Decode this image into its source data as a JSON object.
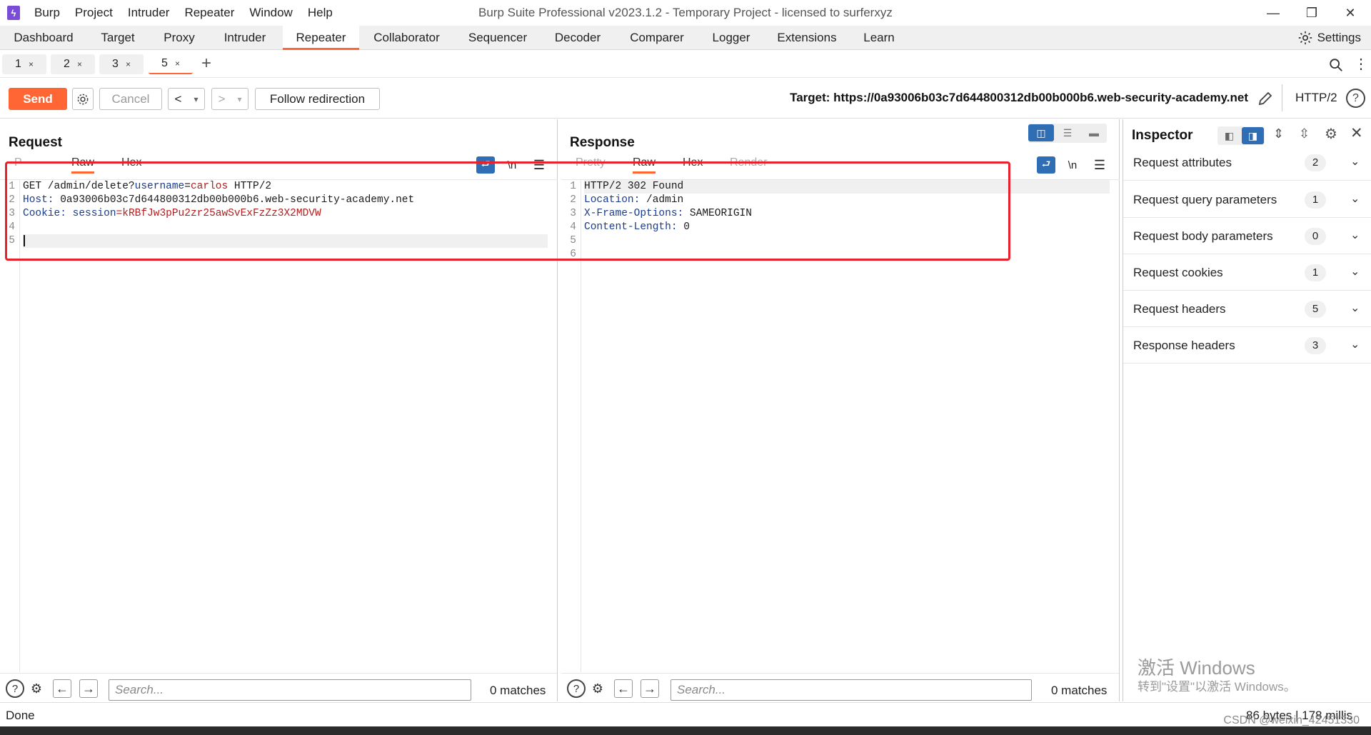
{
  "titlebar": {
    "menu": [
      "Burp",
      "Project",
      "Intruder",
      "Repeater",
      "Window",
      "Help"
    ],
    "title": "Burp Suite Professional v2023.1.2 - Temporary Project - licensed to surferxyz"
  },
  "main_tabs": [
    "Dashboard",
    "Target",
    "Proxy",
    "Intruder",
    "Repeater",
    "Collaborator",
    "Sequencer",
    "Decoder",
    "Comparer",
    "Logger",
    "Extensions",
    "Learn"
  ],
  "active_main_tab": "Repeater",
  "settings_label": "Settings",
  "sub_tabs": [
    {
      "label": "1",
      "close": "×"
    },
    {
      "label": "2",
      "close": "×"
    },
    {
      "label": "3",
      "close": "×"
    },
    {
      "label": "5",
      "close": "×"
    }
  ],
  "add_tab": "+",
  "toolbar": {
    "send": "Send",
    "cancel": "Cancel",
    "follow": "Follow redirection",
    "target": "Target: https://0a93006b03c7d644800312db00b000b6.web-security-academy.net",
    "http": "HTTP/2",
    "nav_back": "<",
    "nav_forward": ">",
    "dropdown": "▾"
  },
  "request": {
    "title": "Request",
    "view_tabs": [
      "P",
      "Raw",
      "Hex"
    ],
    "active_view": "Raw",
    "line_numbers": [
      "1",
      "2",
      "3",
      "4",
      "5"
    ],
    "lines": [
      {
        "a": "GET /admin/delete?",
        "b": "username",
        "c": "=",
        "d": "carlos",
        "e": " HTTP/2"
      },
      {
        "a": "",
        "b": "Host:",
        "c": " 0a93006b03c7d644800312db00b000b6.web-security-academy.net",
        "d": "",
        "e": ""
      },
      {
        "a": "",
        "b": "Cookie:",
        "c": " ",
        "d": "session",
        "e": "=kRBfJw3pPu2zr25awSvExFzZz3X2MDVW"
      },
      {
        "a": "",
        "b": "",
        "c": "",
        "d": "",
        "e": ""
      },
      {
        "a": "",
        "b": "",
        "c": "",
        "d": "",
        "e": ""
      }
    ],
    "search_placeholder": "Search...",
    "matches": "0 matches"
  },
  "response": {
    "title": "Response",
    "view_tabs": [
      "Pretty",
      "Raw",
      "Hex",
      "Render"
    ],
    "active_view": "Raw",
    "line_numbers": [
      "1",
      "2",
      "3",
      "4",
      "5",
      "6"
    ],
    "lines": [
      {
        "k": "HTTP/2 302 Found",
        "v": ""
      },
      {
        "k": "Location:",
        "v": " /admin"
      },
      {
        "k": "X-Frame-Options:",
        "v": " SAMEORIGIN"
      },
      {
        "k": "Content-Length:",
        "v": " 0"
      },
      {
        "k": "",
        "v": ""
      },
      {
        "k": "",
        "v": ""
      }
    ],
    "search_placeholder": "Search...",
    "matches": "0 matches"
  },
  "inspector": {
    "title": "Inspector",
    "rows": [
      {
        "label": "Request attributes",
        "count": "2"
      },
      {
        "label": "Request query parameters",
        "count": "1"
      },
      {
        "label": "Request body parameters",
        "count": "0"
      },
      {
        "label": "Request cookies",
        "count": "1"
      },
      {
        "label": "Request headers",
        "count": "5"
      },
      {
        "label": "Response headers",
        "count": "3"
      }
    ]
  },
  "watermark": {
    "line1": "激活 Windows",
    "line2": "转到\"设置\"以激活 Windows。"
  },
  "status": {
    "left": "Done",
    "right": "86 bytes | 178 millis",
    "csdn": "CSDN @weixin_42451330"
  },
  "colors": {
    "accent": "#ff6633",
    "highlight": "#e8222a",
    "key": "#1a3c8c",
    "value": "#b02020"
  }
}
